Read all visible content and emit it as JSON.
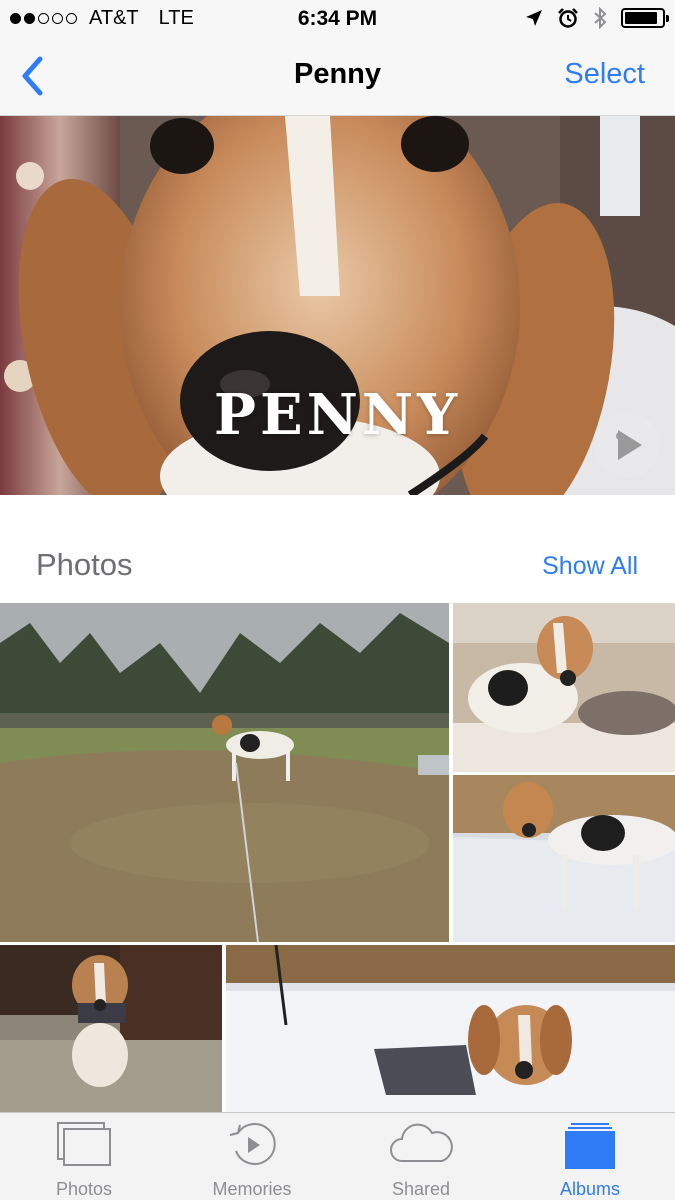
{
  "status_bar": {
    "carrier": "AT&T",
    "network": "LTE",
    "time": "6:34 PM",
    "signal_bars_filled": 2,
    "signal_bars_total": 5,
    "battery_level": 0.9,
    "icons": [
      "location-arrow-icon",
      "alarm-clock-icon",
      "bluetooth-icon",
      "battery-icon"
    ]
  },
  "nav": {
    "back_icon": "chevron-left-icon",
    "title": "Penny",
    "select_label": "Select"
  },
  "hero": {
    "title": "PENNY",
    "play_icon": "play-icon"
  },
  "section": {
    "title": "Photos",
    "show_all_label": "Show All"
  },
  "photos": [
    {
      "subject": "beagle standing on leash in grassy field"
    },
    {
      "subject": "beagle lying on couch with toy"
    },
    {
      "subject": "beagle standing in snow"
    },
    {
      "subject": "beagle sitting on tile floor"
    },
    {
      "subject": "beagle wearing coat in snow"
    }
  ],
  "tab_bar": {
    "tabs": [
      {
        "label": "Photos",
        "icon": "photos-stack-icon",
        "active": false
      },
      {
        "label": "Memories",
        "icon": "memories-play-icon",
        "active": false
      },
      {
        "label": "Shared",
        "icon": "cloud-icon",
        "active": false
      },
      {
        "label": "Albums",
        "icon": "albums-icon",
        "active": true
      }
    ]
  },
  "colors": {
    "accent": "#2f7cf6",
    "bar_background": "#f7f7f7",
    "inactive_tab": "#8e8e93"
  }
}
